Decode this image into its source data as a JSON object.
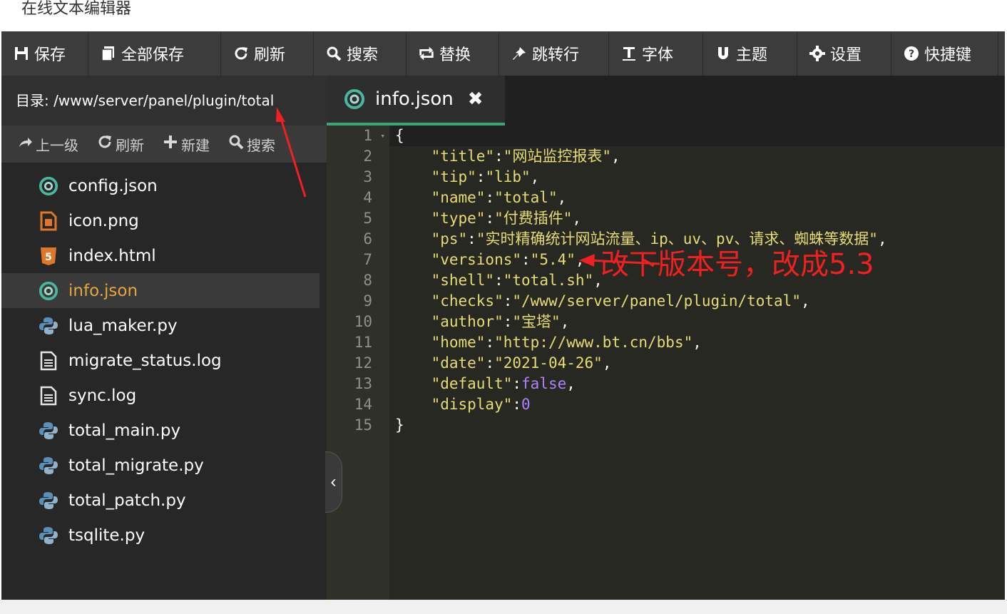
{
  "window": {
    "title": "在线文本编辑器"
  },
  "toolbar": {
    "items": [
      {
        "label": "保存",
        "icon": "save-icon"
      },
      {
        "label": "全部保存",
        "icon": "save-all-icon"
      },
      {
        "label": "刷新",
        "icon": "refresh-icon"
      },
      {
        "label": "搜索",
        "icon": "search-icon"
      },
      {
        "label": "替换",
        "icon": "replace-icon"
      },
      {
        "label": "跳转行",
        "icon": "pin-icon"
      },
      {
        "label": "字体",
        "icon": "text-cursor-icon"
      },
      {
        "label": "主题",
        "icon": "magnet-icon"
      },
      {
        "label": "设置",
        "icon": "gear-icon"
      },
      {
        "label": "快捷键",
        "icon": "help-icon"
      }
    ]
  },
  "sidebar": {
    "directory_label": "目录:",
    "directory_path": "/www/server/panel/plugin/total",
    "tools": [
      {
        "label": "上一级",
        "icon": "share-arrow-icon"
      },
      {
        "label": "刷新",
        "icon": "refresh-icon"
      },
      {
        "label": "新建",
        "icon": "plus-icon"
      },
      {
        "label": "搜索",
        "icon": "search-icon"
      }
    ],
    "files": [
      {
        "name": "config.json",
        "icon": "json-icon"
      },
      {
        "name": "icon.png",
        "icon": "image-file-icon"
      },
      {
        "name": "index.html",
        "icon": "html5-icon"
      },
      {
        "name": "info.json",
        "icon": "json-icon",
        "active": true
      },
      {
        "name": "lua_maker.py",
        "icon": "python-icon"
      },
      {
        "name": "migrate_status.log",
        "icon": "text-file-icon"
      },
      {
        "name": "sync.log",
        "icon": "text-file-icon"
      },
      {
        "name": "total_main.py",
        "icon": "python-icon"
      },
      {
        "name": "total_migrate.py",
        "icon": "python-icon"
      },
      {
        "name": "total_patch.py",
        "icon": "python-icon"
      },
      {
        "name": "tsqlite.py",
        "icon": "python-icon"
      }
    ]
  },
  "editor": {
    "tab": {
      "label": "info.json",
      "icon": "json-icon",
      "close_icon": "close-icon"
    },
    "lines": [
      [
        {
          "t": "{",
          "c": "c"
        }
      ],
      [
        {
          "t": "    ",
          "c": "c"
        },
        {
          "t": "\"title\"",
          "c": "k"
        },
        {
          "t": ":",
          "c": "c"
        },
        {
          "t": "\"网站监控报表\"",
          "c": "v"
        },
        {
          "t": ",",
          "c": "c"
        }
      ],
      [
        {
          "t": "    ",
          "c": "c"
        },
        {
          "t": "\"tip\"",
          "c": "k"
        },
        {
          "t": ":",
          "c": "c"
        },
        {
          "t": "\"lib\"",
          "c": "v"
        },
        {
          "t": ",",
          "c": "c"
        }
      ],
      [
        {
          "t": "    ",
          "c": "c"
        },
        {
          "t": "\"name\"",
          "c": "k"
        },
        {
          "t": ":",
          "c": "c"
        },
        {
          "t": "\"total\"",
          "c": "v"
        },
        {
          "t": ",",
          "c": "c"
        }
      ],
      [
        {
          "t": "    ",
          "c": "c"
        },
        {
          "t": "\"type\"",
          "c": "k"
        },
        {
          "t": ":",
          "c": "c"
        },
        {
          "t": "\"付费插件\"",
          "c": "v"
        },
        {
          "t": ",",
          "c": "c"
        }
      ],
      [
        {
          "t": "    ",
          "c": "c"
        },
        {
          "t": "\"ps\"",
          "c": "k"
        },
        {
          "t": ":",
          "c": "c"
        },
        {
          "t": "\"实时精确统计网站流量、ip、uv、pv、请求、蜘蛛等数据\"",
          "c": "v"
        },
        {
          "t": ",",
          "c": "c"
        }
      ],
      [
        {
          "t": "    ",
          "c": "c"
        },
        {
          "t": "\"versions\"",
          "c": "k"
        },
        {
          "t": ":",
          "c": "c"
        },
        {
          "t": "\"5.4\"",
          "c": "v"
        },
        {
          "t": ",",
          "c": "c"
        }
      ],
      [
        {
          "t": "    ",
          "c": "c"
        },
        {
          "t": "\"shell\"",
          "c": "k"
        },
        {
          "t": ":",
          "c": "c"
        },
        {
          "t": "\"total.sh\"",
          "c": "v"
        },
        {
          "t": ",",
          "c": "c"
        }
      ],
      [
        {
          "t": "    ",
          "c": "c"
        },
        {
          "t": "\"checks\"",
          "c": "k"
        },
        {
          "t": ":",
          "c": "c"
        },
        {
          "t": "\"/www/server/panel/plugin/total\"",
          "c": "v"
        },
        {
          "t": ",",
          "c": "c"
        }
      ],
      [
        {
          "t": "    ",
          "c": "c"
        },
        {
          "t": "\"author\"",
          "c": "k"
        },
        {
          "t": ":",
          "c": "c"
        },
        {
          "t": "\"宝塔\"",
          "c": "v"
        },
        {
          "t": ",",
          "c": "c"
        }
      ],
      [
        {
          "t": "    ",
          "c": "c"
        },
        {
          "t": "\"home\"",
          "c": "k"
        },
        {
          "t": ":",
          "c": "c"
        },
        {
          "t": "\"http://www.bt.cn/bbs\"",
          "c": "v"
        },
        {
          "t": ",",
          "c": "c"
        }
      ],
      [
        {
          "t": "    ",
          "c": "c"
        },
        {
          "t": "\"date\"",
          "c": "k"
        },
        {
          "t": ":",
          "c": "c"
        },
        {
          "t": "\"2021-04-26\"",
          "c": "v"
        },
        {
          "t": ",",
          "c": "c"
        }
      ],
      [
        {
          "t": "    ",
          "c": "c"
        },
        {
          "t": "\"default\"",
          "c": "k"
        },
        {
          "t": ":",
          "c": "c"
        },
        {
          "t": "false",
          "c": "b"
        },
        {
          "t": ",",
          "c": "c"
        }
      ],
      [
        {
          "t": "    ",
          "c": "c"
        },
        {
          "t": "\"display\"",
          "c": "k"
        },
        {
          "t": ":",
          "c": "c"
        },
        {
          "t": "0",
          "c": "b"
        }
      ],
      [
        {
          "t": "}",
          "c": "c"
        }
      ]
    ],
    "line_numbers": [
      "1",
      "2",
      "3",
      "4",
      "5",
      "6",
      "7",
      "8",
      "9",
      "10",
      "11",
      "12",
      "13",
      "14",
      "15"
    ],
    "collapse_icon": "chevron-left-icon"
  },
  "annotation": {
    "text": "改下版本号，改成5.3",
    "color": "#ee2020"
  }
}
